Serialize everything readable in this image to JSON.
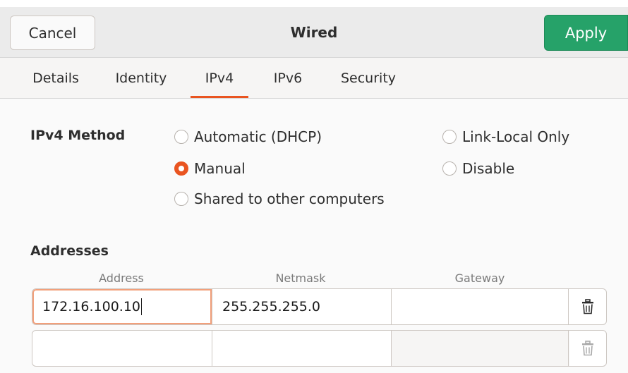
{
  "header": {
    "title": "Wired",
    "cancel_label": "Cancel",
    "apply_label": "Apply"
  },
  "tabs": [
    {
      "label": "Details",
      "active": false
    },
    {
      "label": "Identity",
      "active": false
    },
    {
      "label": "IPv4",
      "active": true
    },
    {
      "label": "IPv6",
      "active": false
    },
    {
      "label": "Security",
      "active": false
    }
  ],
  "ipv4_method": {
    "label": "IPv4 Method",
    "selected": "Manual",
    "options": {
      "automatic": "Automatic (DHCP)",
      "manual": "Manual",
      "shared": "Shared to other computers",
      "link_local": "Link-Local Only",
      "disable": "Disable"
    }
  },
  "addresses": {
    "label": "Addresses",
    "columns": {
      "address": "Address",
      "netmask": "Netmask",
      "gateway": "Gateway"
    },
    "rows": [
      {
        "address": "172.16.100.10",
        "netmask": "255.255.255.0",
        "gateway": ""
      },
      {
        "address": "",
        "netmask": "",
        "gateway": ""
      }
    ]
  },
  "colors": {
    "accent": "#e95420",
    "apply": "#26a269"
  },
  "icons": {
    "delete": "trash-icon"
  }
}
